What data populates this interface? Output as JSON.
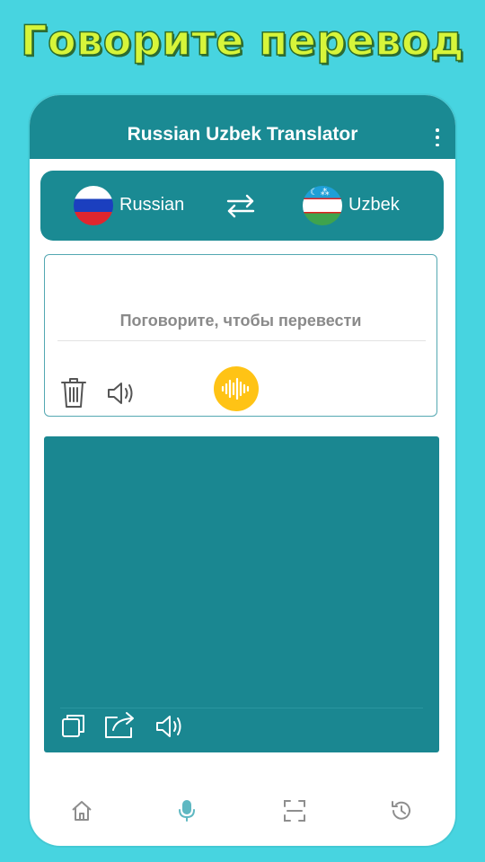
{
  "promo": {
    "headline": "Говорите перевод"
  },
  "app_bar": {
    "title": "Russian Uzbek Translator",
    "menu_icon": "more-vert-icon"
  },
  "languages": {
    "source": {
      "label": "Russian",
      "flag": "russia-flag"
    },
    "target": {
      "label": "Uzbek",
      "flag": "uzbekistan-flag"
    },
    "swap_icon": "swap-arrows-icon"
  },
  "input": {
    "placeholder": "Поговорите, чтобы перевести",
    "actions": [
      "trash-icon",
      "speaker-icon",
      "mic-waveform-icon"
    ]
  },
  "output": {
    "text": "",
    "actions": [
      "copy-icon",
      "share-icon",
      "speaker-icon"
    ]
  },
  "bottom_nav": {
    "items": [
      "home-icon",
      "mic-icon",
      "scan-icon",
      "history-icon"
    ],
    "active": "mic-icon"
  },
  "colors": {
    "background": "#47d4e0",
    "primary": "#1a8a93",
    "accent": "#ffc315",
    "headline": "#d7f53a",
    "nav_active": "#5fb8c2",
    "nav_inactive": "#8e8e8e"
  }
}
